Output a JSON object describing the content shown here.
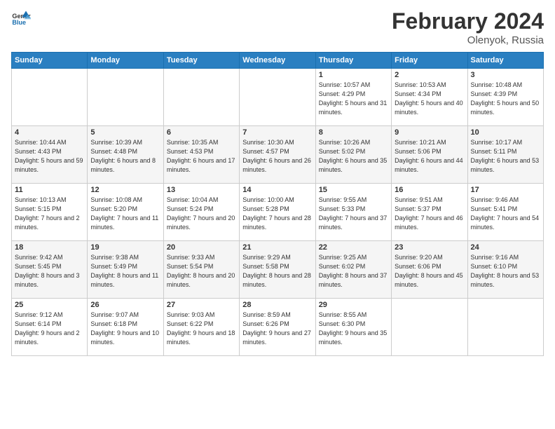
{
  "header": {
    "logo_general": "General",
    "logo_blue": "Blue",
    "month": "February 2024",
    "location": "Olenyok, Russia"
  },
  "days_of_week": [
    "Sunday",
    "Monday",
    "Tuesday",
    "Wednesday",
    "Thursday",
    "Friday",
    "Saturday"
  ],
  "weeks": [
    [
      {
        "day": "",
        "sunrise": "",
        "sunset": "",
        "daylight": ""
      },
      {
        "day": "",
        "sunrise": "",
        "sunset": "",
        "daylight": ""
      },
      {
        "day": "",
        "sunrise": "",
        "sunset": "",
        "daylight": ""
      },
      {
        "day": "",
        "sunrise": "",
        "sunset": "",
        "daylight": ""
      },
      {
        "day": "1",
        "sunrise": "Sunrise: 10:57 AM",
        "sunset": "Sunset: 4:29 PM",
        "daylight": "Daylight: 5 hours and 31 minutes."
      },
      {
        "day": "2",
        "sunrise": "Sunrise: 10:53 AM",
        "sunset": "Sunset: 4:34 PM",
        "daylight": "Daylight: 5 hours and 40 minutes."
      },
      {
        "day": "3",
        "sunrise": "Sunrise: 10:48 AM",
        "sunset": "Sunset: 4:39 PM",
        "daylight": "Daylight: 5 hours and 50 minutes."
      }
    ],
    [
      {
        "day": "4",
        "sunrise": "Sunrise: 10:44 AM",
        "sunset": "Sunset: 4:43 PM",
        "daylight": "Daylight: 5 hours and 59 minutes."
      },
      {
        "day": "5",
        "sunrise": "Sunrise: 10:39 AM",
        "sunset": "Sunset: 4:48 PM",
        "daylight": "Daylight: 6 hours and 8 minutes."
      },
      {
        "day": "6",
        "sunrise": "Sunrise: 10:35 AM",
        "sunset": "Sunset: 4:53 PM",
        "daylight": "Daylight: 6 hours and 17 minutes."
      },
      {
        "day": "7",
        "sunrise": "Sunrise: 10:30 AM",
        "sunset": "Sunset: 4:57 PM",
        "daylight": "Daylight: 6 hours and 26 minutes."
      },
      {
        "day": "8",
        "sunrise": "Sunrise: 10:26 AM",
        "sunset": "Sunset: 5:02 PM",
        "daylight": "Daylight: 6 hours and 35 minutes."
      },
      {
        "day": "9",
        "sunrise": "Sunrise: 10:21 AM",
        "sunset": "Sunset: 5:06 PM",
        "daylight": "Daylight: 6 hours and 44 minutes."
      },
      {
        "day": "10",
        "sunrise": "Sunrise: 10:17 AM",
        "sunset": "Sunset: 5:11 PM",
        "daylight": "Daylight: 6 hours and 53 minutes."
      }
    ],
    [
      {
        "day": "11",
        "sunrise": "Sunrise: 10:13 AM",
        "sunset": "Sunset: 5:15 PM",
        "daylight": "Daylight: 7 hours and 2 minutes."
      },
      {
        "day": "12",
        "sunrise": "Sunrise: 10:08 AM",
        "sunset": "Sunset: 5:20 PM",
        "daylight": "Daylight: 7 hours and 11 minutes."
      },
      {
        "day": "13",
        "sunrise": "Sunrise: 10:04 AM",
        "sunset": "Sunset: 5:24 PM",
        "daylight": "Daylight: 7 hours and 20 minutes."
      },
      {
        "day": "14",
        "sunrise": "Sunrise: 10:00 AM",
        "sunset": "Sunset: 5:28 PM",
        "daylight": "Daylight: 7 hours and 28 minutes."
      },
      {
        "day": "15",
        "sunrise": "Sunrise: 9:55 AM",
        "sunset": "Sunset: 5:33 PM",
        "daylight": "Daylight: 7 hours and 37 minutes."
      },
      {
        "day": "16",
        "sunrise": "Sunrise: 9:51 AM",
        "sunset": "Sunset: 5:37 PM",
        "daylight": "Daylight: 7 hours and 46 minutes."
      },
      {
        "day": "17",
        "sunrise": "Sunrise: 9:46 AM",
        "sunset": "Sunset: 5:41 PM",
        "daylight": "Daylight: 7 hours and 54 minutes."
      }
    ],
    [
      {
        "day": "18",
        "sunrise": "Sunrise: 9:42 AM",
        "sunset": "Sunset: 5:45 PM",
        "daylight": "Daylight: 8 hours and 3 minutes."
      },
      {
        "day": "19",
        "sunrise": "Sunrise: 9:38 AM",
        "sunset": "Sunset: 5:49 PM",
        "daylight": "Daylight: 8 hours and 11 minutes."
      },
      {
        "day": "20",
        "sunrise": "Sunrise: 9:33 AM",
        "sunset": "Sunset: 5:54 PM",
        "daylight": "Daylight: 8 hours and 20 minutes."
      },
      {
        "day": "21",
        "sunrise": "Sunrise: 9:29 AM",
        "sunset": "Sunset: 5:58 PM",
        "daylight": "Daylight: 8 hours and 28 minutes."
      },
      {
        "day": "22",
        "sunrise": "Sunrise: 9:25 AM",
        "sunset": "Sunset: 6:02 PM",
        "daylight": "Daylight: 8 hours and 37 minutes."
      },
      {
        "day": "23",
        "sunrise": "Sunrise: 9:20 AM",
        "sunset": "Sunset: 6:06 PM",
        "daylight": "Daylight: 8 hours and 45 minutes."
      },
      {
        "day": "24",
        "sunrise": "Sunrise: 9:16 AM",
        "sunset": "Sunset: 6:10 PM",
        "daylight": "Daylight: 8 hours and 53 minutes."
      }
    ],
    [
      {
        "day": "25",
        "sunrise": "Sunrise: 9:12 AM",
        "sunset": "Sunset: 6:14 PM",
        "daylight": "Daylight: 9 hours and 2 minutes."
      },
      {
        "day": "26",
        "sunrise": "Sunrise: 9:07 AM",
        "sunset": "Sunset: 6:18 PM",
        "daylight": "Daylight: 9 hours and 10 minutes."
      },
      {
        "day": "27",
        "sunrise": "Sunrise: 9:03 AM",
        "sunset": "Sunset: 6:22 PM",
        "daylight": "Daylight: 9 hours and 18 minutes."
      },
      {
        "day": "28",
        "sunrise": "Sunrise: 8:59 AM",
        "sunset": "Sunset: 6:26 PM",
        "daylight": "Daylight: 9 hours and 27 minutes."
      },
      {
        "day": "29",
        "sunrise": "Sunrise: 8:55 AM",
        "sunset": "Sunset: 6:30 PM",
        "daylight": "Daylight: 9 hours and 35 minutes."
      },
      {
        "day": "",
        "sunrise": "",
        "sunset": "",
        "daylight": ""
      },
      {
        "day": "",
        "sunrise": "",
        "sunset": "",
        "daylight": ""
      }
    ]
  ]
}
